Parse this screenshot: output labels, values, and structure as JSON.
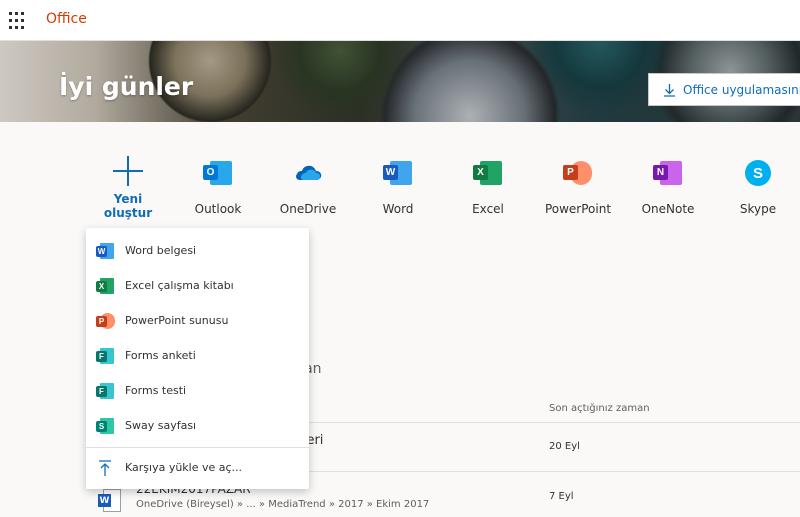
{
  "topbar": {
    "brand": "Office"
  },
  "hero": {
    "greeting": "İyi günler",
    "install_label": "Office uygulamasını yükle"
  },
  "new_item": {
    "label": "Yeni oluştur",
    "chevron": "⌄"
  },
  "apps": [
    {
      "name": "outlook",
      "label": "Outlook",
      "color": "#0078d4",
      "letter": "O",
      "icon": "outlook-icon"
    },
    {
      "name": "onedrive",
      "label": "OneDrive",
      "color": "#0364b8",
      "letter": "",
      "icon": "onedrive-icon"
    },
    {
      "name": "word",
      "label": "Word",
      "color": "#185abd",
      "letter": "W",
      "icon": "word-icon"
    },
    {
      "name": "excel",
      "label": "Excel",
      "color": "#107c41",
      "letter": "X",
      "icon": "excel-icon"
    },
    {
      "name": "powerpoint",
      "label": "PowerPoint",
      "color": "#c43e1c",
      "letter": "P",
      "icon": "powerpoint-icon"
    },
    {
      "name": "onenote",
      "label": "OneNote",
      "color": "#7719aa",
      "letter": "N",
      "icon": "onenote-icon"
    },
    {
      "name": "skype",
      "label": "Skype",
      "color": "#00aff0",
      "letter": "S",
      "icon": "skype-icon"
    }
  ],
  "menu": {
    "items": [
      {
        "label": "Word belgesi",
        "color": "#185abd",
        "letter": "W",
        "icon": "word-icon"
      },
      {
        "label": "Excel çalışma kitabı",
        "color": "#107c41",
        "letter": "X",
        "icon": "excel-icon"
      },
      {
        "label": "PowerPoint sunusu",
        "color": "#c43e1c",
        "letter": "P",
        "icon": "powerpoint-icon"
      },
      {
        "label": "Forms anketi",
        "color": "#077568",
        "letter": "F",
        "icon": "forms-icon"
      },
      {
        "label": "Forms testi",
        "color": "#077568",
        "letter": "F",
        "icon": "forms-icon"
      },
      {
        "label": "Sway sayfası",
        "color": "#008272",
        "letter": "S",
        "icon": "sway-icon"
      }
    ],
    "upload_label": "Karşıya yükle ve aç..."
  },
  "recent": {
    "title_partial": "şılan",
    "column_header": "Son açtığınız zaman",
    "rows": [
      {
        "title_partial": "efteri",
        "date": "20 Eyl"
      },
      {
        "title_partial": "22EKIM2017PAZAR",
        "path": "OneDrive (Bireysel) » ... » MediaTrend » 2017 » Ekim 2017",
        "date": "7 Eyl"
      }
    ]
  },
  "colors": {
    "accent": "#0f6cbd",
    "brand": "#d83b01"
  }
}
